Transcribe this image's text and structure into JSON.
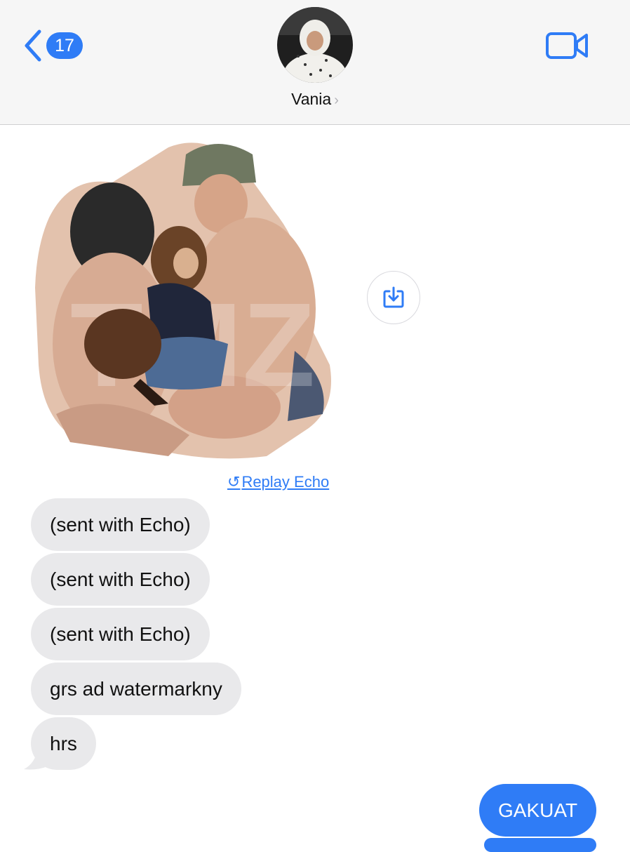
{
  "header": {
    "back_badge": "17",
    "contact_name": "Vania",
    "contact_chevron": "›",
    "icons": {
      "back": "chevron-left-icon",
      "video": "video-camera-icon",
      "save": "download-icon"
    },
    "accent_color": "#2f7cf6"
  },
  "messages": {
    "replay_label": "Replay Echo",
    "replay_glyph": "↺",
    "received": [
      "(sent with Echo)",
      "(sent with Echo)",
      "(sent with Echo)",
      "grs ad watermarkny",
      "hrs"
    ],
    "sent": [
      "GAKUAT"
    ],
    "bubble_colors": {
      "received": "#e9e9eb",
      "sent": "#2f7cf6"
    }
  }
}
